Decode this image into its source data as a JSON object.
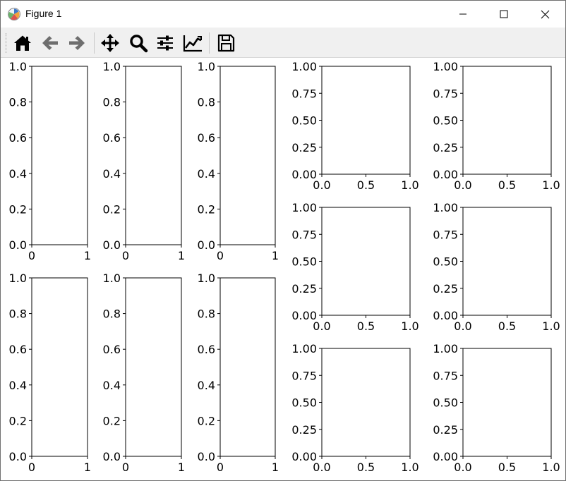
{
  "window": {
    "title": "Figure 1",
    "controls": [
      "minimize",
      "maximize",
      "close"
    ]
  },
  "toolbar": {
    "buttons": [
      {
        "name": "home",
        "icon": "home-icon"
      },
      {
        "name": "back",
        "icon": "arrow-left-icon"
      },
      {
        "name": "forward",
        "icon": "arrow-right-icon"
      },
      {
        "name": "pan",
        "icon": "move-icon"
      },
      {
        "name": "zoom",
        "icon": "magnifier-icon"
      },
      {
        "name": "configure-subplots",
        "icon": "sliders-icon"
      },
      {
        "name": "edit-axes",
        "icon": "line-chart-icon"
      },
      {
        "name": "save",
        "icon": "floppy-disk-icon"
      }
    ]
  },
  "chart_data": [
    {
      "type": "line",
      "series": [],
      "xlim": [
        0,
        1
      ],
      "ylim": [
        0,
        1
      ],
      "xticks": [
        "0",
        "1"
      ],
      "yticks": [
        "0.0",
        "0.2",
        "0.4",
        "0.6",
        "0.8",
        "1.0"
      ]
    },
    {
      "type": "line",
      "series": [],
      "xlim": [
        0,
        1
      ],
      "ylim": [
        0,
        1
      ],
      "xticks": [
        "0",
        "1"
      ],
      "yticks": [
        "0.0",
        "0.2",
        "0.4",
        "0.6",
        "0.8",
        "1.0"
      ]
    },
    {
      "type": "line",
      "series": [],
      "xlim": [
        0,
        1
      ],
      "ylim": [
        0,
        1
      ],
      "xticks": [
        "0",
        "1"
      ],
      "yticks": [
        "0.0",
        "0.2",
        "0.4",
        "0.6",
        "0.8",
        "1.0"
      ]
    },
    {
      "type": "line",
      "series": [],
      "xlim": [
        0,
        1
      ],
      "ylim": [
        0,
        1
      ],
      "xticks": [
        "0",
        "1"
      ],
      "yticks": [
        "0.0",
        "0.2",
        "0.4",
        "0.6",
        "0.8",
        "1.0"
      ]
    },
    {
      "type": "line",
      "series": [],
      "xlim": [
        0,
        1
      ],
      "ylim": [
        0,
        1
      ],
      "xticks": [
        "0",
        "1"
      ],
      "yticks": [
        "0.0",
        "0.2",
        "0.4",
        "0.6",
        "0.8",
        "1.0"
      ]
    },
    {
      "type": "line",
      "series": [],
      "xlim": [
        0,
        1
      ],
      "ylim": [
        0,
        1
      ],
      "xticks": [
        "0",
        "1"
      ],
      "yticks": [
        "0.0",
        "0.2",
        "0.4",
        "0.6",
        "0.8",
        "1.0"
      ]
    },
    {
      "type": "line",
      "series": [],
      "xlim": [
        0,
        1
      ],
      "ylim": [
        0,
        1
      ],
      "xticks": [
        "0.0",
        "0.5",
        "1.0"
      ],
      "yticks": [
        "0.00",
        "0.25",
        "0.50",
        "0.75",
        "1.00"
      ]
    },
    {
      "type": "line",
      "series": [],
      "xlim": [
        0,
        1
      ],
      "ylim": [
        0,
        1
      ],
      "xticks": [
        "0.0",
        "0.5",
        "1.0"
      ],
      "yticks": [
        "0.00",
        "0.25",
        "0.50",
        "0.75",
        "1.00"
      ]
    },
    {
      "type": "line",
      "series": [],
      "xlim": [
        0,
        1
      ],
      "ylim": [
        0,
        1
      ],
      "xticks": [
        "0.0",
        "0.5",
        "1.0"
      ],
      "yticks": [
        "0.00",
        "0.25",
        "0.50",
        "0.75",
        "1.00"
      ]
    },
    {
      "type": "line",
      "series": [],
      "xlim": [
        0,
        1
      ],
      "ylim": [
        0,
        1
      ],
      "xticks": [
        "0.0",
        "0.5",
        "1.0"
      ],
      "yticks": [
        "0.00",
        "0.25",
        "0.50",
        "0.75",
        "1.00"
      ]
    },
    {
      "type": "line",
      "series": [],
      "xlim": [
        0,
        1
      ],
      "ylim": [
        0,
        1
      ],
      "xticks": [
        "0.0",
        "0.5",
        "1.0"
      ],
      "yticks": [
        "0.00",
        "0.25",
        "0.50",
        "0.75",
        "1.00"
      ]
    },
    {
      "type": "line",
      "series": [],
      "xlim": [
        0,
        1
      ],
      "ylim": [
        0,
        1
      ],
      "xticks": [
        "0.0",
        "0.5",
        "1.0"
      ],
      "yticks": [
        "0.00",
        "0.25",
        "0.50",
        "0.75",
        "1.00"
      ]
    }
  ]
}
